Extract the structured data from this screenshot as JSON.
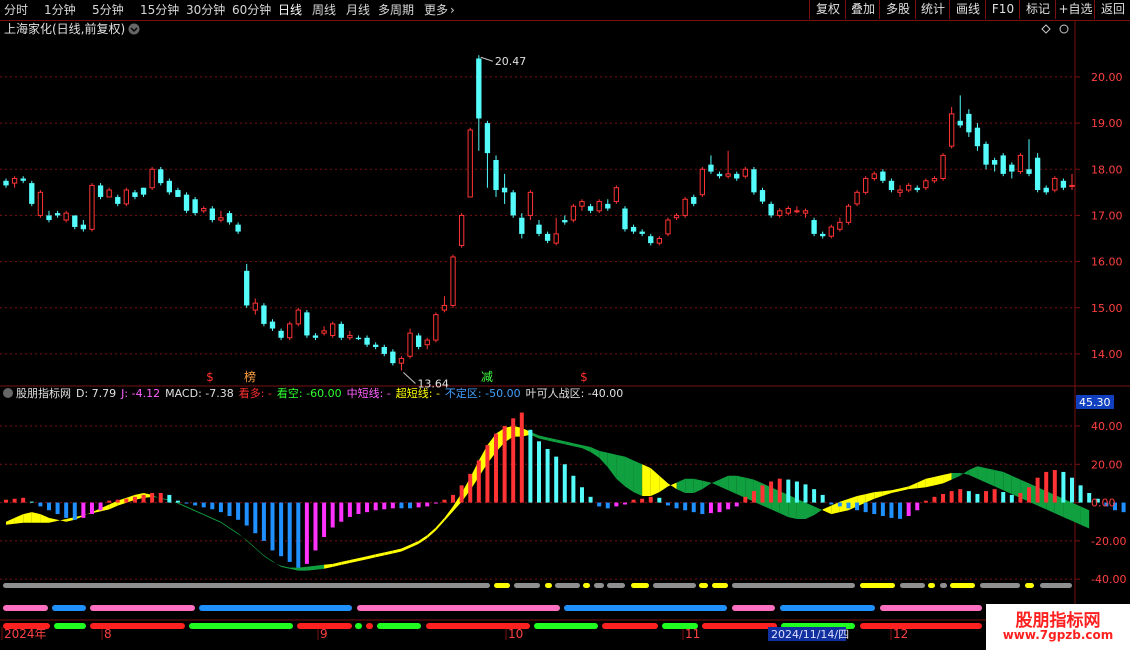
{
  "toolbar": {
    "periods": [
      "分时",
      "1分钟",
      "5分钟",
      "15分钟",
      "30分钟",
      "60分钟",
      "日线",
      "周线",
      "月线",
      "多周期",
      "更多"
    ],
    "active_period": "日线",
    "right_buttons": [
      "复权",
      "叠加",
      "多股",
      "统计",
      "画线",
      "F10",
      "标记",
      "+自选",
      "返回"
    ]
  },
  "main_panel": {
    "title": "上海家化(日线,前复权)",
    "price_ticks": [
      "20.00",
      "19.00",
      "18.00",
      "17.00",
      "16.00",
      "15.00",
      "14.00"
    ],
    "high_label": "20.47",
    "low_label": "13.64",
    "markers": [
      "$",
      "榜",
      "减",
      "$"
    ]
  },
  "indicator_panel": {
    "name": "股朋指标网",
    "d_label": "D: 7.79",
    "j_label": "J: -4.12",
    "macd_label": "MACD: -7.38",
    "kanduo_label": "看多: -",
    "kankong_label": "看空: -60.00",
    "zhongduan_label": "中短线: -",
    "chaoduan_label": "超短线: -",
    "buding_label": "不定区: -50.00",
    "yeke_label": "叶可人战区: -40.00",
    "ticks": [
      "40.00",
      "20.00",
      "0.00",
      "-20.00",
      "-40.00"
    ],
    "current_value": "45.30"
  },
  "date_axis": {
    "labels": [
      "2024年",
      "8",
      "9",
      "10",
      "11",
      "12"
    ],
    "cursor_date": "2024/11/14/四"
  },
  "watermark": {
    "line1": "股朋指标网",
    "line2": "www.7gpzb.com"
  },
  "colors": {
    "up": "#ff3333",
    "down": "#54fcfc",
    "grid": "#7a1010",
    "axis_text": "#ff4040",
    "pink": "#ff32ff",
    "yellow": "#ffff00",
    "green": "#10a040"
  },
  "chart_data": {
    "type": "candlestick",
    "ylim": [
      13.5,
      20.8
    ],
    "candles": [
      [
        17.75,
        17.65,
        17.8,
        17.6
      ],
      [
        17.7,
        17.8,
        17.85,
        17.6
      ],
      [
        17.8,
        17.75,
        17.85,
        17.7
      ],
      [
        17.7,
        17.25,
        17.75,
        17.2
      ],
      [
        17.0,
        17.5,
        17.55,
        16.95
      ],
      [
        17.0,
        16.9,
        17.1,
        16.85
      ],
      [
        17.05,
        17.0,
        17.1,
        16.95
      ],
      [
        16.9,
        17.05,
        17.1,
        16.85
      ],
      [
        17.0,
        16.75,
        17.0,
        16.7
      ],
      [
        16.8,
        16.7,
        16.9,
        16.65
      ],
      [
        16.7,
        17.65,
        17.7,
        16.65
      ],
      [
        17.65,
        17.4,
        17.7,
        17.35
      ],
      [
        17.4,
        17.55,
        17.6,
        17.4
      ],
      [
        17.4,
        17.25,
        17.45,
        17.2
      ],
      [
        17.25,
        17.55,
        17.6,
        17.2
      ],
      [
        17.5,
        17.4,
        17.55,
        17.35
      ],
      [
        17.6,
        17.45,
        17.6,
        17.4
      ],
      [
        17.6,
        18.0,
        18.05,
        17.55
      ],
      [
        18.0,
        17.7,
        18.05,
        17.65
      ],
      [
        17.75,
        17.5,
        17.8,
        17.45
      ],
      [
        17.55,
        17.4,
        17.6,
        17.4
      ],
      [
        17.45,
        17.1,
        17.5,
        17.05
      ],
      [
        17.35,
        17.05,
        17.4,
        17.0
      ],
      [
        17.1,
        17.15,
        17.2,
        17.05
      ],
      [
        17.15,
        16.9,
        17.2,
        16.85
      ],
      [
        16.9,
        16.95,
        17.1,
        16.85
      ],
      [
        17.05,
        16.85,
        17.1,
        16.8
      ],
      [
        16.8,
        16.65,
        16.85,
        16.6
      ],
      [
        15.8,
        15.05,
        15.95,
        15.0
      ],
      [
        14.95,
        15.1,
        15.2,
        14.85
      ],
      [
        15.05,
        14.65,
        15.1,
        14.6
      ],
      [
        14.7,
        14.55,
        14.75,
        14.5
      ],
      [
        14.5,
        14.35,
        14.55,
        14.3
      ],
      [
        14.35,
        14.65,
        14.7,
        14.3
      ],
      [
        14.65,
        14.95,
        15.0,
        14.6
      ],
      [
        14.9,
        14.4,
        14.95,
        14.35
      ],
      [
        14.4,
        14.35,
        14.45,
        14.3
      ],
      [
        14.45,
        14.5,
        14.6,
        14.4
      ],
      [
        14.4,
        14.65,
        14.7,
        14.35
      ],
      [
        14.65,
        14.35,
        14.7,
        14.3
      ],
      [
        14.35,
        14.4,
        14.5,
        14.3
      ],
      [
        14.35,
        14.32,
        14.4,
        14.3
      ],
      [
        14.35,
        14.2,
        14.4,
        14.15
      ],
      [
        14.2,
        14.15,
        14.25,
        14.1
      ],
      [
        14.15,
        14.0,
        14.2,
        13.95
      ],
      [
        14.05,
        13.8,
        14.1,
        13.75
      ],
      [
        13.8,
        13.9,
        13.95,
        13.64
      ],
      [
        13.95,
        14.45,
        14.55,
        13.9
      ],
      [
        14.4,
        14.15,
        14.45,
        14.1
      ],
      [
        14.2,
        14.3,
        14.35,
        14.1
      ],
      [
        14.3,
        14.85,
        14.9,
        14.25
      ],
      [
        14.95,
        15.05,
        15.25,
        14.9
      ],
      [
        15.05,
        16.1,
        16.15,
        15.0
      ],
      [
        16.35,
        17.0,
        17.05,
        16.3
      ],
      [
        17.4,
        18.85,
        18.9,
        17.4
      ],
      [
        20.4,
        19.1,
        20.47,
        18.4
      ],
      [
        19.0,
        18.35,
        19.05,
        17.6
      ],
      [
        18.2,
        17.55,
        18.3,
        17.4
      ],
      [
        17.6,
        17.5,
        17.9,
        17.25
      ],
      [
        17.5,
        17.0,
        17.55,
        16.95
      ],
      [
        16.95,
        16.6,
        17.05,
        16.5
      ],
      [
        17.0,
        17.5,
        17.55,
        16.9
      ],
      [
        16.8,
        16.6,
        16.9,
        16.55
      ],
      [
        16.6,
        16.45,
        16.65,
        16.4
      ],
      [
        16.4,
        16.6,
        16.95,
        16.35
      ],
      [
        16.9,
        16.85,
        17.0,
        16.8
      ],
      [
        16.9,
        17.2,
        17.25,
        16.85
      ],
      [
        17.2,
        17.3,
        17.35,
        17.1
      ],
      [
        17.2,
        17.1,
        17.25,
        17.05
      ],
      [
        17.1,
        17.3,
        17.35,
        17.05
      ],
      [
        17.25,
        17.15,
        17.35,
        17.1
      ],
      [
        17.3,
        17.6,
        17.65,
        17.25
      ],
      [
        17.15,
        16.7,
        17.2,
        16.65
      ],
      [
        16.75,
        16.65,
        16.8,
        16.6
      ],
      [
        16.65,
        16.6,
        16.7,
        16.55
      ],
      [
        16.55,
        16.4,
        16.6,
        16.35
      ],
      [
        16.4,
        16.5,
        16.55,
        16.35
      ],
      [
        16.6,
        16.9,
        16.95,
        16.55
      ],
      [
        16.95,
        17.0,
        17.05,
        16.9
      ],
      [
        17.0,
        17.35,
        17.4,
        16.95
      ],
      [
        17.4,
        17.25,
        17.45,
        17.2
      ],
      [
        17.45,
        18.0,
        18.05,
        17.4
      ],
      [
        18.1,
        17.95,
        18.3,
        17.9
      ],
      [
        17.9,
        17.85,
        17.95,
        17.8
      ],
      [
        17.85,
        17.9,
        18.4,
        17.8
      ],
      [
        17.9,
        17.8,
        17.95,
        17.75
      ],
      [
        17.85,
        18.0,
        18.05,
        17.8
      ],
      [
        18.0,
        17.5,
        18.05,
        17.45
      ],
      [
        17.55,
        17.3,
        17.6,
        17.25
      ],
      [
        17.25,
        17.0,
        17.3,
        16.95
      ],
      [
        17.0,
        17.1,
        17.15,
        16.95
      ],
      [
        17.05,
        17.15,
        17.2,
        17.0
      ],
      [
        17.1,
        17.1,
        17.2,
        17.05
      ],
      [
        17.05,
        17.1,
        17.15,
        16.95
      ],
      [
        16.9,
        16.6,
        16.95,
        16.55
      ],
      [
        16.6,
        16.55,
        16.65,
        16.5
      ],
      [
        16.55,
        16.75,
        16.8,
        16.5
      ],
      [
        16.7,
        16.85,
        16.95,
        16.65
      ],
      [
        16.85,
        17.2,
        17.25,
        16.8
      ],
      [
        17.25,
        17.5,
        17.55,
        17.2
      ],
      [
        17.5,
        17.8,
        17.85,
        17.45
      ],
      [
        17.8,
        17.9,
        17.95,
        17.75
      ],
      [
        17.95,
        17.75,
        18.0,
        17.7
      ],
      [
        17.75,
        17.55,
        17.8,
        17.5
      ],
      [
        17.5,
        17.55,
        17.65,
        17.4
      ],
      [
        17.55,
        17.65,
        17.7,
        17.5
      ],
      [
        17.6,
        17.55,
        17.65,
        17.5
      ],
      [
        17.6,
        17.75,
        17.8,
        17.55
      ],
      [
        17.75,
        17.8,
        17.85,
        17.7
      ],
      [
        17.8,
        18.3,
        18.35,
        17.75
      ],
      [
        18.5,
        19.2,
        19.35,
        18.45
      ],
      [
        19.05,
        18.95,
        19.6,
        18.9
      ],
      [
        19.2,
        18.8,
        19.3,
        18.7
      ],
      [
        18.9,
        18.5,
        19.0,
        18.4
      ],
      [
        18.55,
        18.1,
        18.6,
        18.0
      ],
      [
        18.2,
        18.1,
        18.25,
        17.95
      ],
      [
        18.3,
        17.9,
        18.35,
        17.85
      ],
      [
        18.1,
        17.95,
        18.15,
        17.8
      ],
      [
        17.95,
        18.3,
        18.35,
        17.9
      ],
      [
        18.0,
        17.9,
        18.65,
        17.85
      ],
      [
        18.25,
        17.55,
        18.35,
        17.5
      ],
      [
        17.6,
        17.5,
        17.65,
        17.45
      ],
      [
        17.55,
        17.8,
        17.85,
        17.5
      ],
      [
        17.75,
        17.6,
        17.8,
        17.55
      ],
      [
        17.65,
        17.65,
        17.9,
        17.55
      ]
    ],
    "indicator_ylim": [
      -42,
      52
    ],
    "indicator_bars": [
      1.5,
      2,
      2.5,
      0.5,
      -2,
      -4,
      -6,
      -8,
      -9,
      -8,
      -6,
      -4,
      1,
      1.5,
      2,
      3,
      4,
      5,
      5,
      4,
      1,
      -0.5,
      -1.5,
      -2.5,
      -3.5,
      -5,
      -7,
      -9,
      -12,
      -16,
      -20,
      -25,
      -28,
      -31,
      -34,
      -32,
      -25,
      -18,
      -13,
      -10,
      -7.5,
      -6,
      -5,
      -4,
      -3.5,
      -3,
      -3,
      -3,
      -2.5,
      -2,
      -0.5,
      1.5,
      4,
      9,
      15,
      22,
      30,
      36,
      40,
      44,
      47,
      38,
      32,
      28,
      24,
      20,
      14,
      8,
      3,
      -2,
      -3,
      -2,
      -1,
      1.5,
      2,
      3,
      2.5,
      -1.5,
      -3,
      -4,
      -5,
      -6,
      -5.5,
      -5,
      -3.5,
      -2,
      3,
      6,
      9,
      11,
      12.5,
      12,
      11,
      9.5,
      7,
      4,
      -1,
      -2,
      -3,
      -4,
      -5,
      -6,
      -7,
      -8,
      -8.5,
      -7,
      -4,
      1,
      3,
      4.5,
      6,
      7,
      6,
      4.5,
      6,
      7,
      5.5,
      4,
      5,
      8,
      13,
      16,
      17,
      16,
      13,
      9,
      5,
      2,
      -2,
      -4,
      -5,
      -6,
      -7
    ],
    "band_top": [
      -10,
      -8,
      -6,
      -5,
      -6,
      -8,
      -9,
      -10,
      -9,
      -7,
      -5,
      -3,
      -1,
      1,
      2.5,
      4,
      5,
      4,
      2,
      1,
      0,
      -2,
      -4,
      -6,
      -8,
      -10,
      -13,
      -16,
      -20,
      -24,
      -28,
      -31,
      -33,
      -34,
      -34,
      -33.5,
      -33,
      -32.5,
      -32,
      -31,
      -30,
      -29,
      -28,
      -27,
      -26,
      -25,
      -24,
      -22,
      -20,
      -17,
      -13,
      -8,
      -2,
      5,
      13,
      22,
      30,
      36,
      39,
      40,
      39,
      37,
      35,
      34,
      33,
      32,
      31,
      30,
      29,
      27,
      26,
      25,
      24,
      22,
      20,
      18,
      14,
      10,
      7,
      5,
      5,
      7,
      10,
      12,
      14,
      14,
      13,
      12,
      10,
      8,
      6,
      4,
      2,
      0,
      -2,
      -4,
      -6,
      -5,
      -4,
      -2,
      0,
      2,
      3.5,
      5,
      6,
      7,
      7.5,
      8,
      9,
      10,
      12,
      14,
      17,
      19,
      18,
      17,
      16,
      14,
      12,
      10,
      8,
      6,
      4,
      2,
      0,
      -2,
      -4,
      -6,
      -8,
      -10,
      -12
    ],
    "band_bottom": [
      -10,
      -9.5,
      -9,
      -9,
      -9,
      -9,
      -8,
      -7,
      -6,
      -5,
      -4,
      -3,
      -2,
      0,
      1.5,
      3,
      4,
      4.5,
      4,
      3,
      1,
      -1,
      -3,
      -5,
      -7,
      -9,
      -12,
      -15,
      -18,
      -22,
      -26,
      -29,
      -32,
      -33,
      -34,
      -34,
      -33.5,
      -33,
      -32,
      -31,
      -30,
      -29,
      -28,
      -27,
      -26,
      -25,
      -24,
      -22,
      -20,
      -17,
      -13,
      -8,
      -3,
      2,
      8,
      15,
      22,
      28,
      33,
      36,
      36,
      37,
      35,
      34,
      33,
      32,
      31,
      30,
      28,
      25,
      20,
      14,
      10,
      7,
      5,
      5,
      7,
      10,
      12,
      14,
      14,
      13,
      12,
      10,
      8,
      6,
      4,
      2,
      0,
      -2,
      -4,
      -6,
      -7,
      -7,
      -5,
      -2,
      0,
      2,
      3.5,
      5,
      6,
      7,
      7.5,
      8,
      9,
      10,
      12,
      14,
      15,
      16,
      17,
      17,
      16,
      14,
      12,
      10,
      8,
      6,
      4,
      2,
      0,
      -2,
      -4,
      -6,
      -8,
      -10,
      -12
    ],
    "band_colors": [
      "y",
      "y",
      "y",
      "y",
      "y",
      "y",
      "y",
      "y",
      "y",
      "y",
      "y",
      "y",
      "y",
      "y",
      "y",
      "y",
      "y",
      "g",
      "g",
      "g",
      "g",
      "g",
      "g",
      "g",
      "g",
      "g",
      "g",
      "g",
      "g",
      "g",
      "g",
      "g",
      "g",
      "g",
      "g",
      "g",
      "g",
      "y",
      "y",
      "y",
      "y",
      "y",
      "y",
      "y",
      "y",
      "y",
      "y",
      "y",
      "y",
      "y",
      "y",
      "y",
      "y",
      "y",
      "y",
      "y",
      "y",
      "y",
      "y",
      "y",
      "y",
      "g",
      "g",
      "g",
      "g",
      "g",
      "g",
      "g",
      "g",
      "g",
      "g",
      "g",
      "g",
      "g",
      "y",
      "y",
      "y",
      "y",
      "g",
      "g",
      "g",
      "g",
      "g",
      "g",
      "g",
      "g",
      "g",
      "g",
      "g",
      "g",
      "g",
      "g",
      "g",
      "g",
      "g",
      "y",
      "y",
      "y",
      "y",
      "y",
      "y",
      "y",
      "y",
      "y",
      "y",
      "y",
      "y",
      "y",
      "y",
      "y",
      "g",
      "g",
      "g",
      "g",
      "g",
      "g",
      "g",
      "g",
      "g",
      "g",
      "g",
      "g",
      "g",
      "g",
      "g",
      "g",
      "g",
      "g",
      "g",
      "g",
      "g",
      "g"
    ]
  }
}
